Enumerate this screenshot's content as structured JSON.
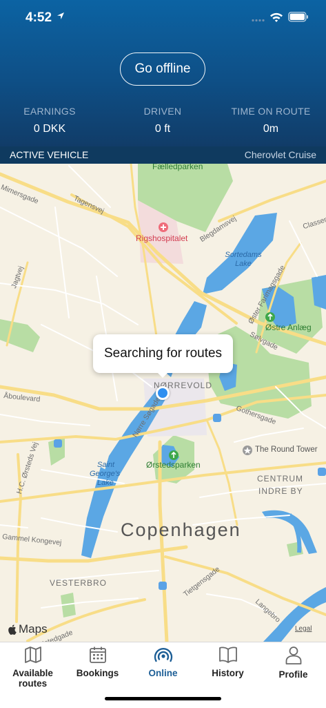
{
  "status_bar": {
    "time": "4:52"
  },
  "header": {
    "toggle_button": "Go offline",
    "stats": [
      {
        "label": "EARNINGS",
        "value": "0 DKK"
      },
      {
        "label": "DRIVEN",
        "value": "0 ft"
      },
      {
        "label": "TIME ON ROUTE",
        "value": "0m"
      }
    ]
  },
  "vehicle": {
    "label": "ACTIVE VEHICLE",
    "value": "Cherovlet Cruise"
  },
  "map": {
    "callout": "Searching for routes",
    "labels": {
      "faelledparken": "Fælledparken",
      "rigshospitalet": "Rigshospitalet",
      "sortedams_lake": "Sortedams Lake",
      "ostre_anlaeg": "Østre Anlæg",
      "norrevold": "NØRREVOLD",
      "orstedsparken": "Ørstedsparken",
      "round_tower": "The Round Tower",
      "centrum": "CENTRUM",
      "indre_by": "INDRE BY",
      "copenhagen": "Copenhagen",
      "vesterbro": "VESTERBRO",
      "st_georges_lake_1": "Saint",
      "st_georges_lake_2": "George's",
      "st_georges_lake_3": "Lake",
      "mimersgade": "Mimersgade",
      "tagensvej": "Tagensvej",
      "blegdamsvej": "Blegdamsvej",
      "classen": "Classen",
      "jagtvej": "Jagtvej",
      "oster_farimagsgade": "Øster Farimagsgade",
      "solvgade": "Sølvgade",
      "aboulevard": "Åboulevard",
      "norre_sogade": "Nørre Søgade",
      "gothersgade": "Gothersgade",
      "hc_orsteds_vej": "H.C. Ørsteds Vej",
      "gammel_kongevej": "Gammel Kongevej",
      "tietgensgade": "Tietgensgade",
      "langebro": "Langebro",
      "istedgade": "Istedgade"
    },
    "attribution": "Maps",
    "legal": "Legal"
  },
  "tabs": [
    {
      "label": "Available routes",
      "icon": "map-icon",
      "active": false
    },
    {
      "label": "Bookings",
      "icon": "calendar-icon",
      "active": false
    },
    {
      "label": "Online",
      "icon": "broadcast-icon",
      "active": true
    },
    {
      "label": "History",
      "icon": "book-icon",
      "active": false
    },
    {
      "label": "Profile",
      "icon": "person-icon",
      "active": false
    }
  ],
  "colors": {
    "header_top": "#0c63a3",
    "header_bottom": "#113c68",
    "vehicle_bar": "#0f3a5f",
    "active_tab": "#1c5e96",
    "water": "#5ba7e4",
    "park": "#b8dda4",
    "road": "#f8dd87"
  }
}
